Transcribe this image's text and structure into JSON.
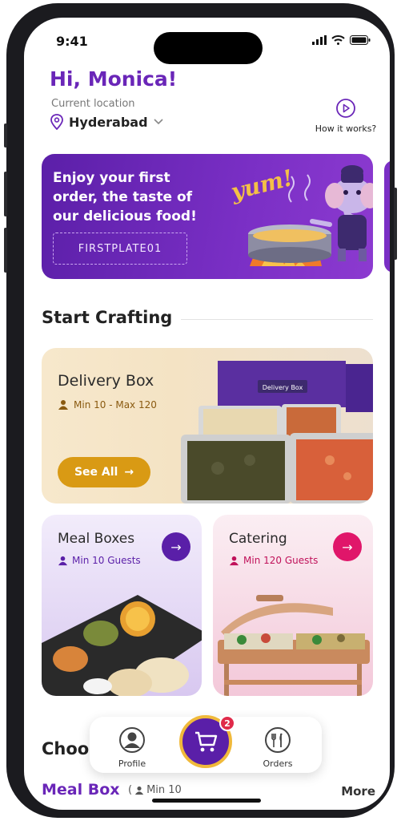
{
  "status": {
    "time": "9:41"
  },
  "header": {
    "greeting": "Hi, Monica!",
    "location_label": "Current location",
    "city": "Hyderabad",
    "how_it_works": "How it works?"
  },
  "promo": {
    "text": "Enjoy your first order, the taste of our delicious food!",
    "coupon_code": "FIRSTPLATE01",
    "mascot_text": "yum!",
    "box_label": "Delivery Box"
  },
  "start_crafting": {
    "title": "Start Crafting",
    "delivery_box": {
      "title": "Delivery Box",
      "subtitle": "Min 10 - Max 120",
      "cta": "See All"
    },
    "meal_boxes": {
      "title": "Meal Boxes",
      "subtitle": "Min 10 Guests",
      "accent": "#5a1fa8"
    },
    "catering": {
      "title": "Catering",
      "subtitle": "Min 120 Guests",
      "accent": "#e0166a"
    }
  },
  "choose": {
    "title": "Choo",
    "tab_active": "Meal Box",
    "tab_min": "Min 10",
    "more": "More"
  },
  "bottom_nav": {
    "profile": "Profile",
    "orders": "Orders",
    "cart_count": "2"
  },
  "colors": {
    "brand_purple": "#6a26b8",
    "gold": "#d99a14",
    "pink": "#e0166a"
  }
}
